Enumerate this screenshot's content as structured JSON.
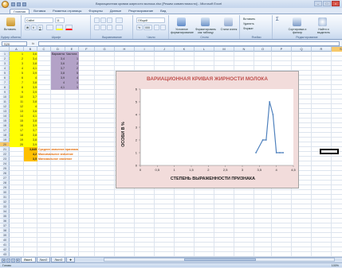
{
  "window": {
    "title": "Вариационная кривая жирности молока.xlsx [Режим совместимости] - Microsoft Excel",
    "controls": [
      "–",
      "□",
      "×"
    ]
  },
  "ribbon": {
    "tabs": [
      "Главная",
      "Вставка",
      "Разметка страницы",
      "Формулы",
      "Данные",
      "Рецензирование",
      "Вид"
    ],
    "active_tab": "Главная",
    "groups": {
      "clipboard": {
        "label": "Буфер обмена",
        "paste": "Вставить"
      },
      "font": {
        "label": "Шрифт",
        "name": "Calibri",
        "size": "11",
        "bold": "Ж",
        "italic": "К",
        "underline": "Ч"
      },
      "alignment": {
        "label": "Выравнивание"
      },
      "number": {
        "label": "Число",
        "format": "Общий",
        "percent": "%",
        "thousands": "000"
      },
      "styles": {
        "label": "Стили",
        "conditional": "Условное форматирование",
        "table": "Форматировать как таблицу",
        "cell_styles": "Стили ячеек"
      },
      "cells": {
        "label": "Ячейки",
        "insert": "Вставить",
        "delete": "Удалить",
        "format": "Формат"
      },
      "editing": {
        "label": "Редактирование",
        "sort": "Сортировка и фильтр",
        "find": "Найти и выделить"
      }
    }
  },
  "formula_bar": {
    "name_box": "S20",
    "fx": "fx",
    "formula": ""
  },
  "columns": [
    "A",
    "B",
    "C",
    "D",
    "E",
    "F",
    "G",
    "H",
    "I",
    "J",
    "K",
    "L",
    "M",
    "N",
    "O",
    "P",
    "Q",
    "R",
    "S"
  ],
  "selected_column": "S",
  "rows": [
    "1",
    "2",
    "3",
    "4",
    "5",
    "6",
    "7",
    "8",
    "9",
    "10",
    "11",
    "12",
    "13",
    "14",
    "15",
    "16",
    "17",
    "18",
    "19",
    "20",
    "21",
    "22",
    "23",
    "24",
    "25",
    "26",
    "27",
    "28",
    "29",
    "30",
    "31",
    "32",
    "33",
    "34",
    "35",
    "36",
    "37",
    "38",
    "39",
    "40",
    "41",
    "42",
    "43"
  ],
  "table": {
    "col_a": [
      "1",
      "2",
      "3",
      "4",
      "5",
      "6",
      "7",
      "8",
      "9",
      "10",
      "11",
      "12",
      "13",
      "14",
      "15",
      "16",
      "17",
      "18",
      "19",
      "20"
    ],
    "col_b": [
      "3,6",
      "3,4",
      "3,8",
      "4,1",
      "3,9",
      "4",
      "3,8",
      "3,9",
      "3,9",
      "3,7",
      "3,8",
      "4",
      "3,6",
      "4,1",
      "3,8",
      "3,9",
      "3,7",
      "3,8",
      "3,8",
      "3,9"
    ],
    "header_d": "Варианта",
    "header_e": "Частота",
    "col_d": [
      "3,4",
      "3,6",
      "3,7",
      "3,8",
      "3,9",
      "4",
      "4,1"
    ],
    "col_e": [
      "1",
      "2",
      "2",
      "5",
      "4",
      "1",
      "1"
    ]
  },
  "stats": [
    {
      "value": "3,845",
      "label": "Среднее значение признака"
    },
    {
      "value": "4,2",
      "label": "Максимальное значение"
    },
    {
      "value": "3,5",
      "label": "Минимальное значение"
    }
  ],
  "chart_data": {
    "type": "line",
    "title": "ВАРИАЦИОННАЯ КРИВАЯ ЖИРНОСТИ МОЛОКА",
    "xlabel": "СТЕПЕНЬ ВЫРАЖЕННОСТИ ПРИЗНАКА",
    "ylabel": "ОСОБИ В %",
    "x": [
      3.4,
      3.6,
      3.7,
      3.8,
      3.9,
      4.0,
      4.1,
      4.2
    ],
    "values": [
      1,
      2,
      2,
      5,
      4,
      1,
      1,
      1
    ],
    "xlim": [
      0,
      4.5
    ],
    "ylim": [
      0,
      6
    ],
    "xticks": [
      "0",
      "0,5",
      "1",
      "1,5",
      "2",
      "2,5",
      "3",
      "3,5",
      "4",
      "4,5"
    ],
    "yticks": [
      "0",
      "1",
      "2",
      "3",
      "4",
      "5",
      "6"
    ],
    "line_color": "#4f81bd",
    "background": "#f2dcdb",
    "title_color": "#c0504d"
  },
  "sheet_tabs": [
    "Лист1",
    "Лист2",
    "Лист3"
  ],
  "active_sheet": "Лист1",
  "status": {
    "ready": "Готово",
    "zoom": "100%"
  }
}
